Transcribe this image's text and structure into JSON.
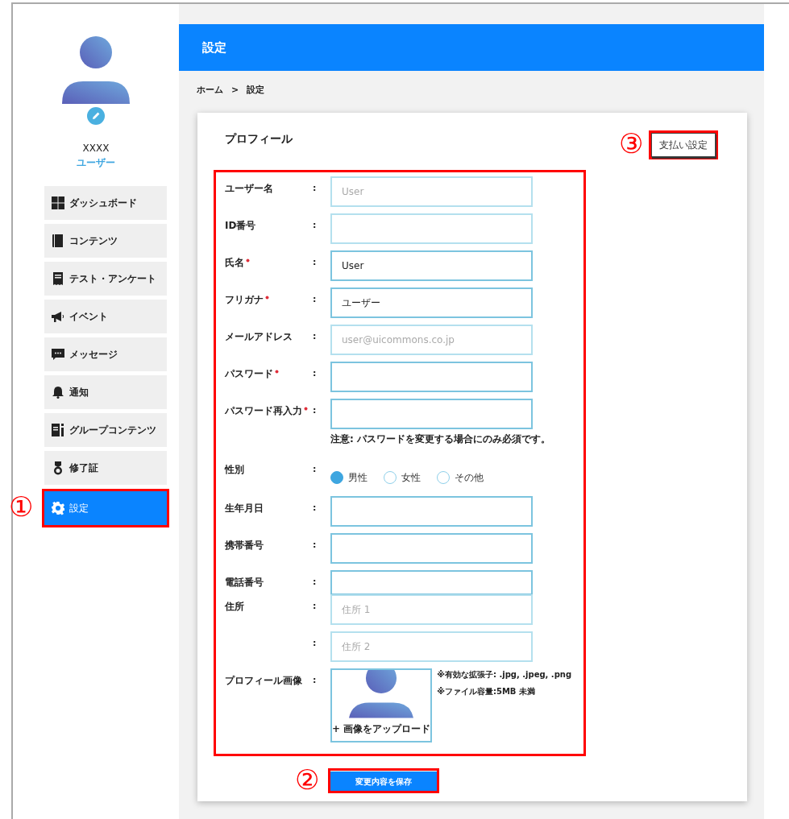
{
  "user": {
    "name": "XXXX",
    "role": "ユーザー"
  },
  "nav": [
    {
      "label": "ダッシュボード",
      "selected": false
    },
    {
      "label": "コンテンツ",
      "selected": false
    },
    {
      "label": "テスト・アンケート",
      "selected": false
    },
    {
      "label": "イベント",
      "selected": false
    },
    {
      "label": "メッセージ",
      "selected": false
    },
    {
      "label": "通知",
      "selected": false
    },
    {
      "label": "グループコンテンツ",
      "selected": false
    },
    {
      "label": "修了証",
      "selected": false
    },
    {
      "label": "設定",
      "selected": true,
      "callout": "①"
    }
  ],
  "header": {
    "title": "設定"
  },
  "breadcrumb": {
    "items": [
      "ホーム",
      "設定"
    ],
    "separator": ">"
  },
  "card": {
    "title": "プロフィール",
    "payment_button": {
      "label": "支払い設定",
      "callout": "③"
    }
  },
  "form": {
    "highlighted": true,
    "fields": [
      {
        "kind": "text",
        "label": "ユーザー名",
        "colon": ":",
        "required": false,
        "placeholder": "User"
      },
      {
        "kind": "text",
        "label": "ID番号",
        "colon": ":",
        "required": false
      },
      {
        "kind": "text",
        "label": "氏名",
        "colon": ":",
        "required": true,
        "value": "User"
      },
      {
        "kind": "text",
        "label": "フリガナ",
        "colon": ":",
        "required": true,
        "value": "ユーザー"
      },
      {
        "kind": "text",
        "label": "メールアドレス",
        "colon": ":",
        "required": false,
        "placeholder": "user@uicommons.co.jp"
      },
      {
        "kind": "text",
        "label": "パスワード",
        "colon": ":",
        "required": true
      },
      {
        "kind": "text",
        "label": "パスワード再入力",
        "colon": ":",
        "required": true,
        "note": "注意: パスワードを変更する場合にのみ必須です。"
      },
      {
        "kind": "radio",
        "label": "性別",
        "colon": ":",
        "required": false,
        "options": [
          {
            "label": "男性",
            "selected": true
          },
          {
            "label": "女性",
            "selected": false
          },
          {
            "label": "その他",
            "selected": false
          }
        ]
      },
      {
        "kind": "text",
        "label": "生年月日",
        "colon": ":",
        "required": false
      },
      {
        "kind": "text",
        "label": "携帯番号",
        "colon": ":",
        "required": false
      },
      {
        "kind": "text",
        "label": "電話番号",
        "colon": ":",
        "required": false,
        "attached_below": true
      },
      {
        "kind": "text",
        "label": "住所",
        "colon": ":",
        "required": false,
        "placeholder": "住所 1"
      },
      {
        "kind": "text",
        "colon": ":",
        "required": false,
        "placeholder": "住所 2"
      },
      {
        "kind": "image",
        "label": "プロフィール画像",
        "colon": ":",
        "required": false,
        "upload_label": "+ 画像をアップロード",
        "notes": [
          "※有効な拡張子: .jpg, .jpeg, .png",
          "※ファイル容量:5MB 未満"
        ]
      }
    ]
  },
  "save_button": {
    "label": "変更内容を保存",
    "callout": "②"
  }
}
